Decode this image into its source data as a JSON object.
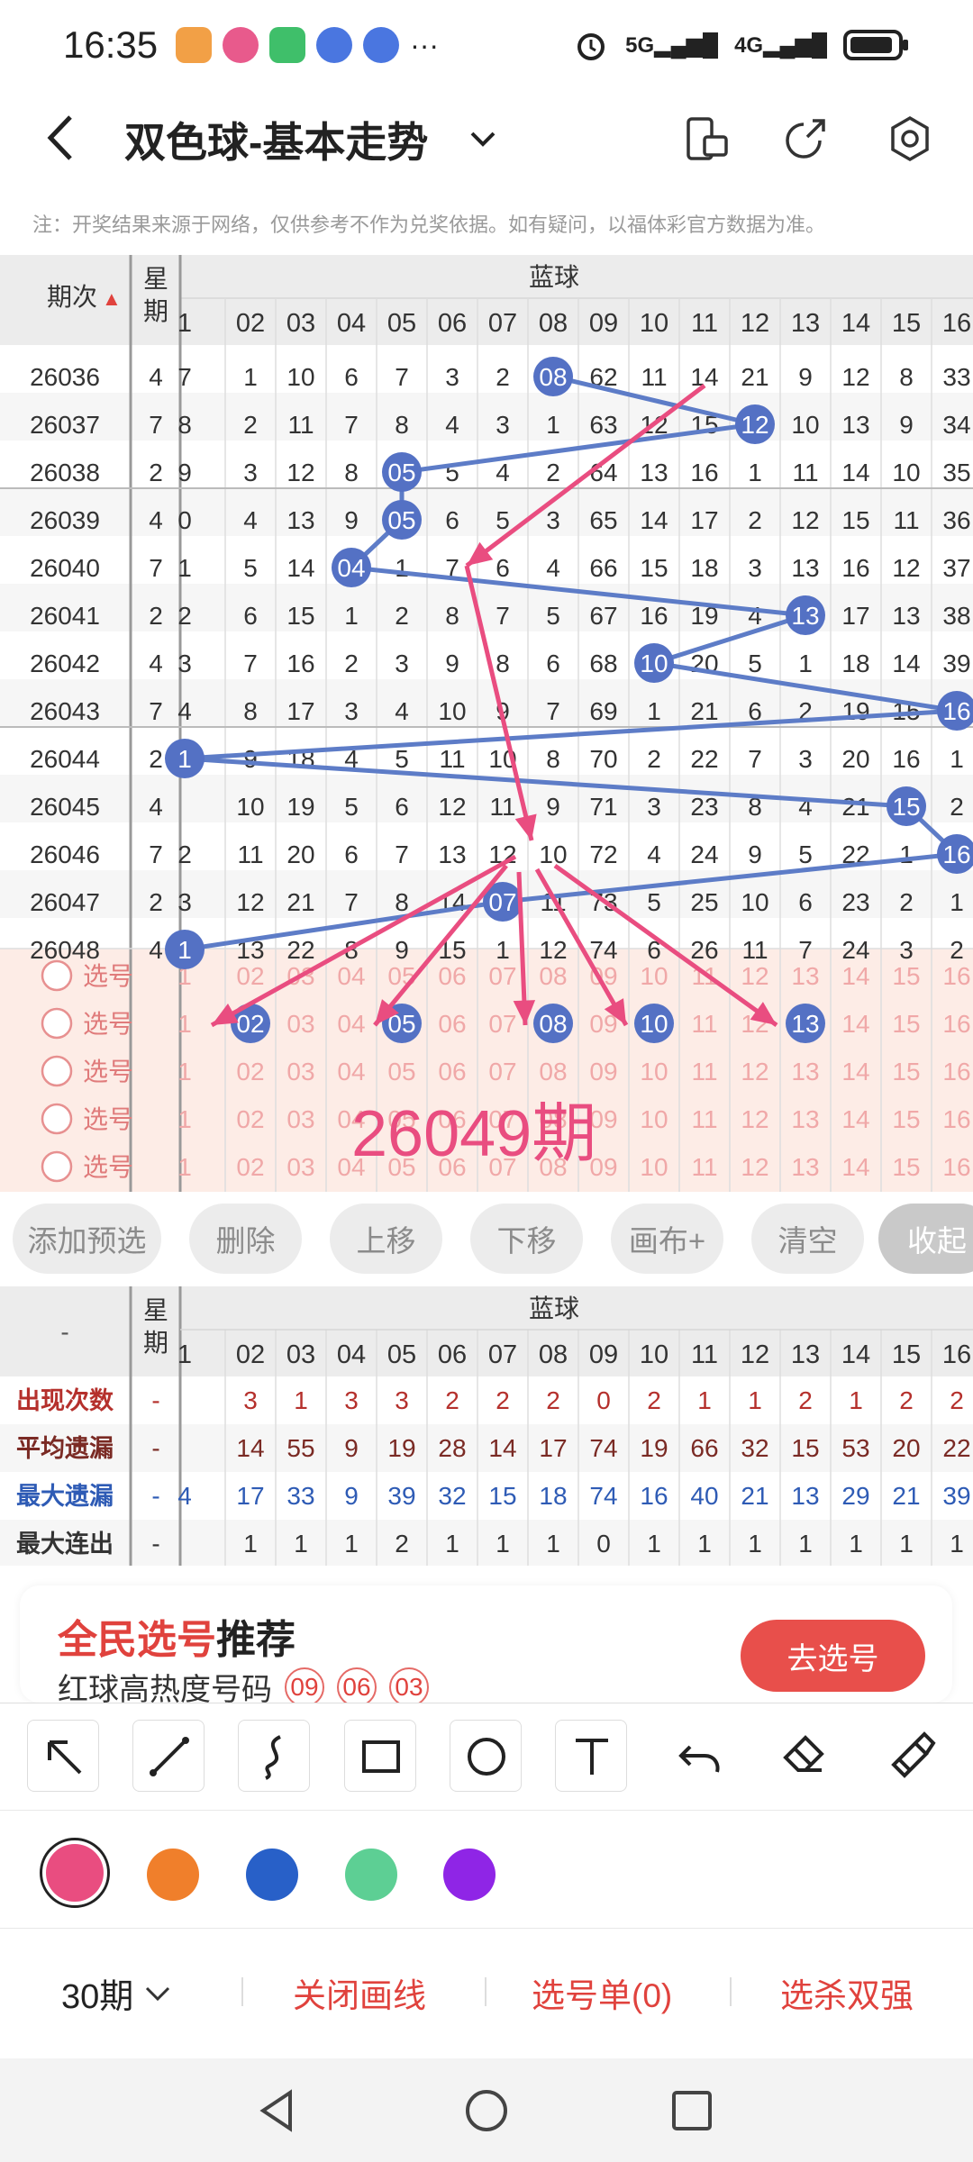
{
  "status_bar": {
    "time": "16:35",
    "net1": "5G",
    "net2": "4G"
  },
  "header": {
    "title": "双色球-基本走势"
  },
  "notice": "注：开奖结果来源于网络，仅供参考不作为兑奖依据。如有疑问，以福体彩官方数据为准。",
  "table": {
    "period_header": "期次",
    "weekday_header": "星期",
    "section_header": "蓝球",
    "col_headers": [
      "1",
      "02",
      "03",
      "04",
      "05",
      "06",
      "07",
      "08",
      "09",
      "10",
      "11",
      "12",
      "13",
      "14",
      "15",
      "16"
    ],
    "rows": [
      {
        "period": "26036",
        "wd": "4",
        "cells": [
          "7",
          "1",
          "10",
          "6",
          "7",
          "3",
          "2",
          "08",
          "62",
          "11",
          "14",
          "21",
          "9",
          "12",
          "8",
          "33"
        ],
        "hit": 7
      },
      {
        "period": "26037",
        "wd": "7",
        "cells": [
          "8",
          "2",
          "11",
          "7",
          "8",
          "4",
          "3",
          "1",
          "63",
          "12",
          "15",
          "12",
          "10",
          "13",
          "9",
          "34"
        ],
        "hit": 11
      },
      {
        "period": "26038",
        "wd": "2",
        "cells": [
          "9",
          "3",
          "12",
          "8",
          "05",
          "5",
          "4",
          "2",
          "64",
          "13",
          "16",
          "1",
          "11",
          "14",
          "10",
          "35"
        ],
        "hit": 4
      },
      {
        "period": "26039",
        "wd": "4",
        "cells": [
          "0",
          "4",
          "13",
          "9",
          "05",
          "6",
          "5",
          "3",
          "65",
          "14",
          "17",
          "2",
          "12",
          "15",
          "11",
          "36"
        ],
        "hit": 4
      },
      {
        "period": "26040",
        "wd": "7",
        "cells": [
          "1",
          "5",
          "14",
          "04",
          "1",
          "7",
          "6",
          "4",
          "66",
          "15",
          "18",
          "3",
          "13",
          "16",
          "12",
          "37"
        ],
        "hit": 3
      },
      {
        "period": "26041",
        "wd": "2",
        "cells": [
          "2",
          "6",
          "15",
          "1",
          "2",
          "8",
          "7",
          "5",
          "67",
          "16",
          "19",
          "4",
          "13",
          "17",
          "13",
          "38"
        ],
        "hit": 12
      },
      {
        "period": "26042",
        "wd": "4",
        "cells": [
          "3",
          "7",
          "16",
          "2",
          "3",
          "9",
          "8",
          "6",
          "68",
          "10",
          "20",
          "5",
          "1",
          "18",
          "14",
          "39"
        ],
        "hit": 9
      },
      {
        "period": "26043",
        "wd": "7",
        "cells": [
          "4",
          "8",
          "17",
          "3",
          "4",
          "10",
          "9",
          "7",
          "69",
          "1",
          "21",
          "6",
          "2",
          "19",
          "15",
          "16"
        ],
        "hit": 15
      },
      {
        "period": "26044",
        "wd": "2",
        "cells": [
          "1",
          "9",
          "18",
          "4",
          "5",
          "11",
          "10",
          "8",
          "70",
          "2",
          "22",
          "7",
          "3",
          "20",
          "16",
          "1"
        ],
        "hit": 0
      },
      {
        "period": "26045",
        "wd": "4",
        "cells": [
          "",
          "10",
          "19",
          "5",
          "6",
          "12",
          "11",
          "9",
          "71",
          "3",
          "23",
          "8",
          "4",
          "21",
          "15",
          "2"
        ],
        "hit": 14
      },
      {
        "period": "26046",
        "wd": "7",
        "cells": [
          "2",
          "11",
          "20",
          "6",
          "7",
          "13",
          "12",
          "10",
          "72",
          "4",
          "24",
          "9",
          "5",
          "22",
          "1",
          "16"
        ],
        "hit": 15
      },
      {
        "period": "26047",
        "wd": "2",
        "cells": [
          "3",
          "12",
          "21",
          "7",
          "8",
          "14",
          "07",
          "11",
          "73",
          "5",
          "25",
          "10",
          "6",
          "23",
          "2",
          "1"
        ],
        "hit": 6
      },
      {
        "period": "26048",
        "wd": "4",
        "cells": [
          "1",
          "13",
          "22",
          "8",
          "9",
          "15",
          "1",
          "12",
          "74",
          "6",
          "26",
          "11",
          "7",
          "24",
          "3",
          "2"
        ],
        "hit": 0
      }
    ],
    "pick_label": "选号",
    "pick_rows": [
      [],
      [
        1,
        4,
        7,
        9,
        12
      ],
      [],
      [],
      []
    ],
    "overlay_text": "26049期"
  },
  "toolbar": [
    "添加预选",
    "删除",
    "上移",
    "下移",
    "画布+",
    "清空",
    "收起"
  ],
  "stats": {
    "section_header": "蓝球",
    "corner": "-",
    "weekday_header": "星期",
    "rows": [
      {
        "label": "出现次数",
        "wd": "-",
        "values": [
          "",
          "3",
          "1",
          "3",
          "3",
          "2",
          "2",
          "2",
          "0",
          "2",
          "1",
          "1",
          "2",
          "1",
          "2",
          "2"
        ],
        "color": "#b5302c"
      },
      {
        "label": "平均遗漏",
        "wd": "-",
        "values": [
          "",
          "14",
          "55",
          "9",
          "19",
          "28",
          "14",
          "17",
          "74",
          "19",
          "66",
          "32",
          "15",
          "53",
          "20",
          "22"
        ],
        "color": "#7a2a24"
      },
      {
        "label": "最大遗漏",
        "wd": "-",
        "values": [
          "4",
          "17",
          "33",
          "9",
          "39",
          "32",
          "15",
          "18",
          "74",
          "16",
          "40",
          "21",
          "13",
          "29",
          "21",
          "39"
        ],
        "color": "#2e5bb5"
      },
      {
        "label": "最大连出",
        "wd": "-",
        "values": [
          "",
          "1",
          "1",
          "1",
          "2",
          "1",
          "1",
          "1",
          "0",
          "1",
          "1",
          "1",
          "1",
          "1",
          "1",
          "1"
        ],
        "color": "#333"
      }
    ]
  },
  "promo": {
    "title_red": "全民选号",
    "title_black": "推荐",
    "sub": "红球高热度号码",
    "hot": [
      "09",
      "06",
      "03"
    ],
    "button": "去选号"
  },
  "draw_tools": [
    "arrow-tool-icon",
    "line-tool-icon",
    "curve-tool-icon",
    "rect-tool-icon",
    "circle-tool-icon",
    "text-tool-icon",
    "undo-icon",
    "eraser-icon",
    "clear-brush-icon"
  ],
  "colors": [
    "#e94d80",
    "#f07f2b",
    "#2860c8",
    "#5dcf94",
    "#8f25e6"
  ],
  "bottom": {
    "period": "30期",
    "close_line": "关闭画线",
    "list": "选号单(0)",
    "kill": "选杀双强"
  }
}
